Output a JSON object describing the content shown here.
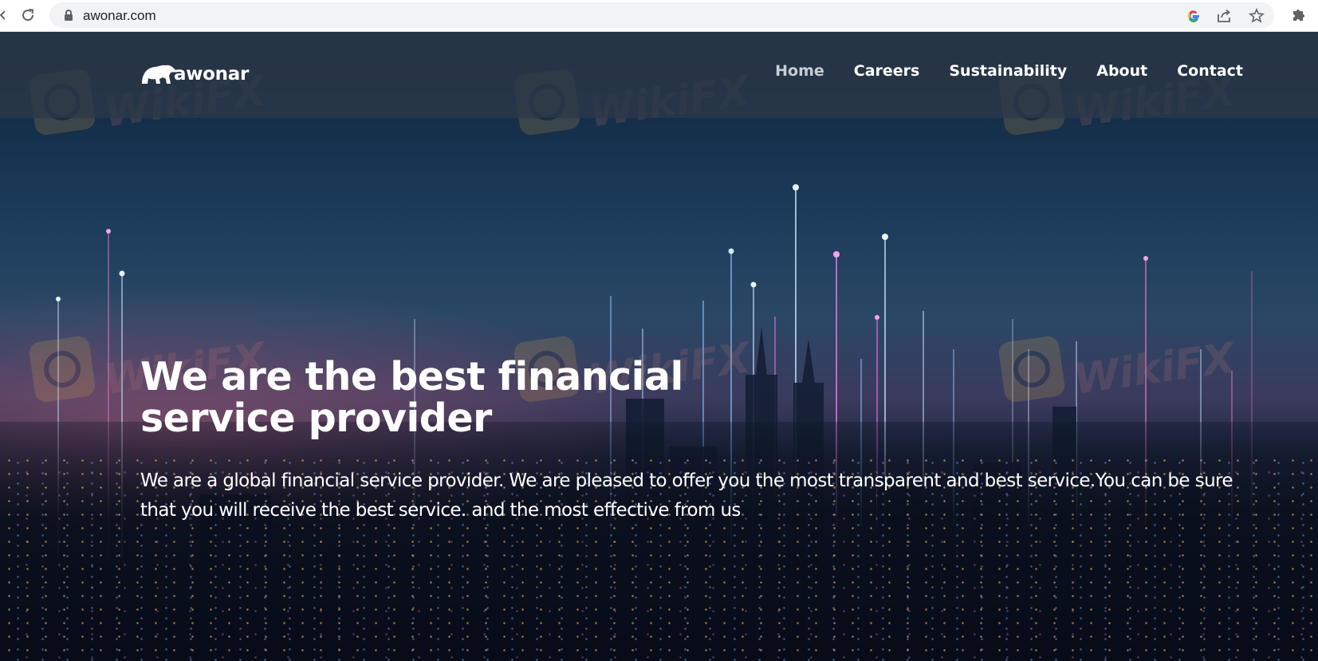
{
  "browser": {
    "url": "awonar.com"
  },
  "site": {
    "logo_text": "awonar",
    "nav": [
      {
        "label": "Home",
        "active": true
      },
      {
        "label": "Careers",
        "active": false
      },
      {
        "label": "Sustainability",
        "active": false
      },
      {
        "label": "About",
        "active": false
      },
      {
        "label": "Contact",
        "active": false
      }
    ]
  },
  "hero": {
    "headline_line1": "We are the best financial",
    "headline_line2": "service provider",
    "subtext": "We are a global financial service provider. We are pleased to offer you the most transparent and best service.You can be sure that you will receive the best service. and the most effective from us"
  },
  "watermark": {
    "text": "WikiFX"
  },
  "colors": {
    "nav_active": "#c9ced6",
    "nav_text": "#ffffff",
    "watermark_badge": "#e8b04a"
  }
}
